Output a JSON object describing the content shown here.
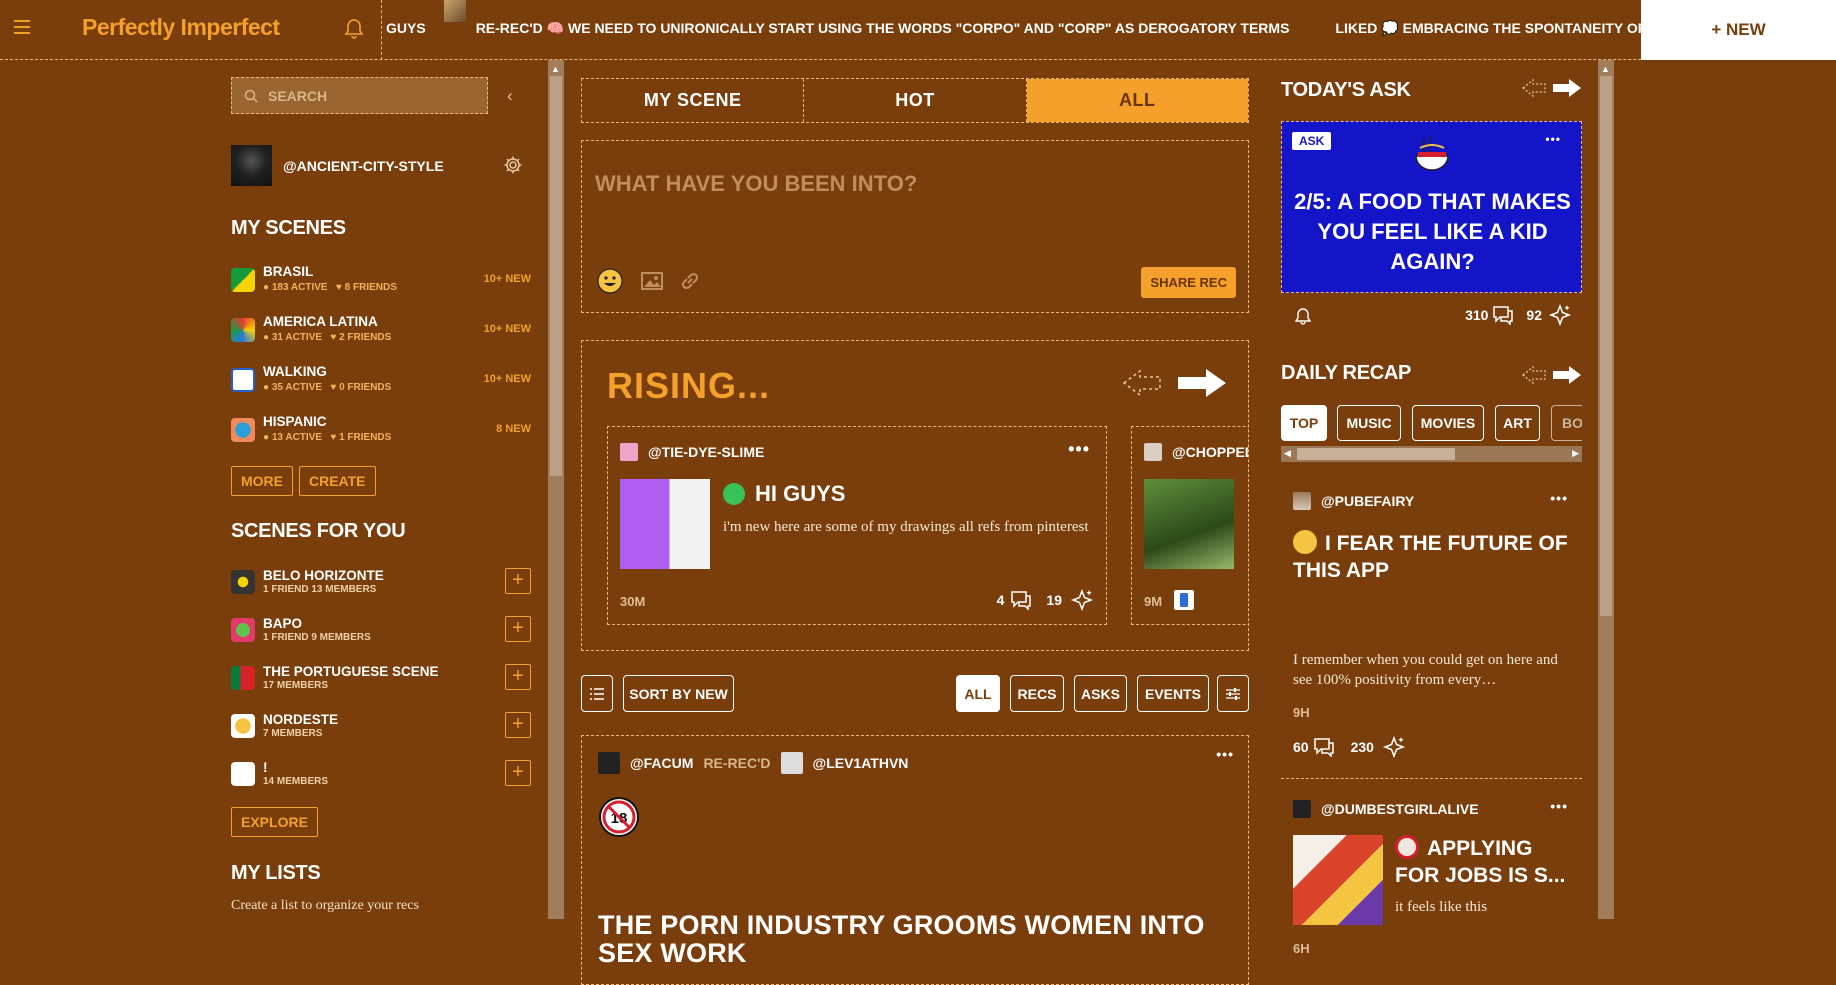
{
  "app": {
    "logo": "Perfectly Imperfect",
    "new_button": "+ NEW",
    "ticker": [
      "GUYS",
      "RE-REC'D 🧠 WE NEED TO UNIRONICALLY START USING THE WORDS \"CORPO\" AND \"CORP\" AS DEROGATORY TERMS",
      "LIKED 💭 EMBRACING THE SPONTANEITY OF IT"
    ]
  },
  "sidebar": {
    "search_placeholder": "SEARCH",
    "profile_handle": "@ANCIENT-CITY-STYLE",
    "my_scenes_title": "MY SCENES",
    "my_scenes": [
      {
        "name": "BRASIL",
        "active": "183 ACTIVE",
        "friends": "8 FRIENDS",
        "new": "10+ NEW"
      },
      {
        "name": "AMERICA LATINA",
        "active": "31 ACTIVE",
        "friends": "2 FRIENDS",
        "new": "10+ NEW"
      },
      {
        "name": "WALKING",
        "active": "35 ACTIVE",
        "friends": "0 FRIENDS",
        "new": "10+ NEW"
      },
      {
        "name": "HISPANIC",
        "active": "13 ACTIVE",
        "friends": "1 FRIENDS",
        "new": "8 NEW"
      }
    ],
    "more_label": "MORE",
    "create_label": "CREATE",
    "scenes_for_you_title": "SCENES FOR YOU",
    "scenes_for_you": [
      {
        "name": "BELO HORIZONTE",
        "meta": "1 FRIEND   13 MEMBERS"
      },
      {
        "name": "BAPO",
        "meta": "1 FRIEND   9 MEMBERS"
      },
      {
        "name": "THE PORTUGUESE SCENE",
        "meta": "17 MEMBERS"
      },
      {
        "name": "NORDESTE",
        "meta": "7 MEMBERS"
      },
      {
        "name": "!",
        "meta": "14 MEMBERS"
      }
    ],
    "explore_label": "EXPLORE",
    "my_lists_title": "MY LISTS",
    "my_lists_desc": "Create a list to organize your recs"
  },
  "feed": {
    "tabs": [
      "MY SCENE",
      "HOT",
      "ALL"
    ],
    "active_tab": "ALL",
    "composer_placeholder": "WHAT HAVE YOU BEEN INTO?",
    "share_rec_label": "SHARE REC",
    "rising_title": "RISING...",
    "rising_cards": [
      {
        "handle": "@TIE-DYE-SLIME",
        "title": "HI GUYS",
        "body": "i'm new here are some of my drawings all refs from pinterest",
        "time": "30M",
        "comments": "4",
        "likes": "19"
      },
      {
        "handle": "@CHOPPED",
        "time": "9M"
      }
    ],
    "filters": {
      "sort_label": "SORT BY NEW",
      "types": [
        "ALL",
        "RECS",
        "ASKS",
        "EVENTS"
      ]
    },
    "post": {
      "author": "@FACUM",
      "rerec_label": "RE-REC'D",
      "rerec_by": "@LEV1ATHVN",
      "title": "THE PORN INDUSTRY GROOMS WOMEN INTO SEX WORK"
    }
  },
  "right": {
    "todays_ask_title": "TODAY'S ASK",
    "ask_badge": "ASK",
    "ask_text": "2/5: A FOOD THAT MAKES YOU FEEL LIKE A KID AGAIN?",
    "ask_comments": "310",
    "ask_likes": "92",
    "daily_recap_title": "DAILY RECAP",
    "recap_tabs": [
      "TOP",
      "MUSIC",
      "MOVIES",
      "ART",
      "BO"
    ],
    "recap_cards": [
      {
        "handle": "@PUBEFAIRY",
        "title": "I FEAR THE FUTURE OF THIS APP",
        "body": "I remember when you could get on here and see 100% positivity from every…",
        "time": "9H",
        "comments": "60",
        "likes": "230"
      },
      {
        "handle": "@DUMBESTGIRLALIVE",
        "title": "APPLYING FOR JOBS IS S...",
        "body": "it feels like this",
        "time": "6H"
      }
    ]
  },
  "colors": {
    "background": "#7a3e0c",
    "accent": "#f5a02a",
    "ask_blue": "#1414c8"
  }
}
